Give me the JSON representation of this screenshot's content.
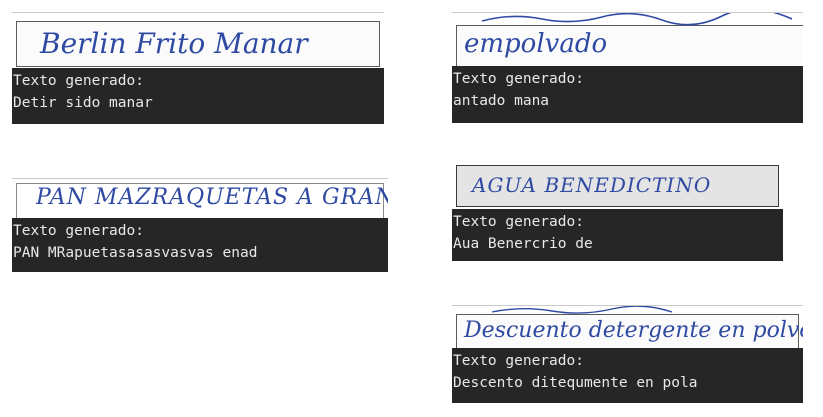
{
  "colors": {
    "terminal_bg": "#262626",
    "terminal_text": "#e8e8e8",
    "ink": "#2f4aa3"
  },
  "panels": [
    {
      "handwriting": "Berlin Frito Manar",
      "label": "Texto generado:",
      "output": "Detir sido manar"
    },
    {
      "handwriting": "empolvado",
      "label": "Texto generado:",
      "output": "antado mana"
    },
    {
      "handwriting": "PAN MAZRAQUETAS A GRANEL",
      "label": "Texto generado:",
      "output": "PAN MRapuetasasasvasvas enad"
    },
    {
      "handwriting": "AGUA BENEDICTINO",
      "label": "Texto generado:",
      "output": "Aua Benercrio de"
    },
    {
      "handwriting": "Descuento detergente en polvo",
      "label": "Texto generado:",
      "output": "Descento ditequmente en pola"
    }
  ]
}
